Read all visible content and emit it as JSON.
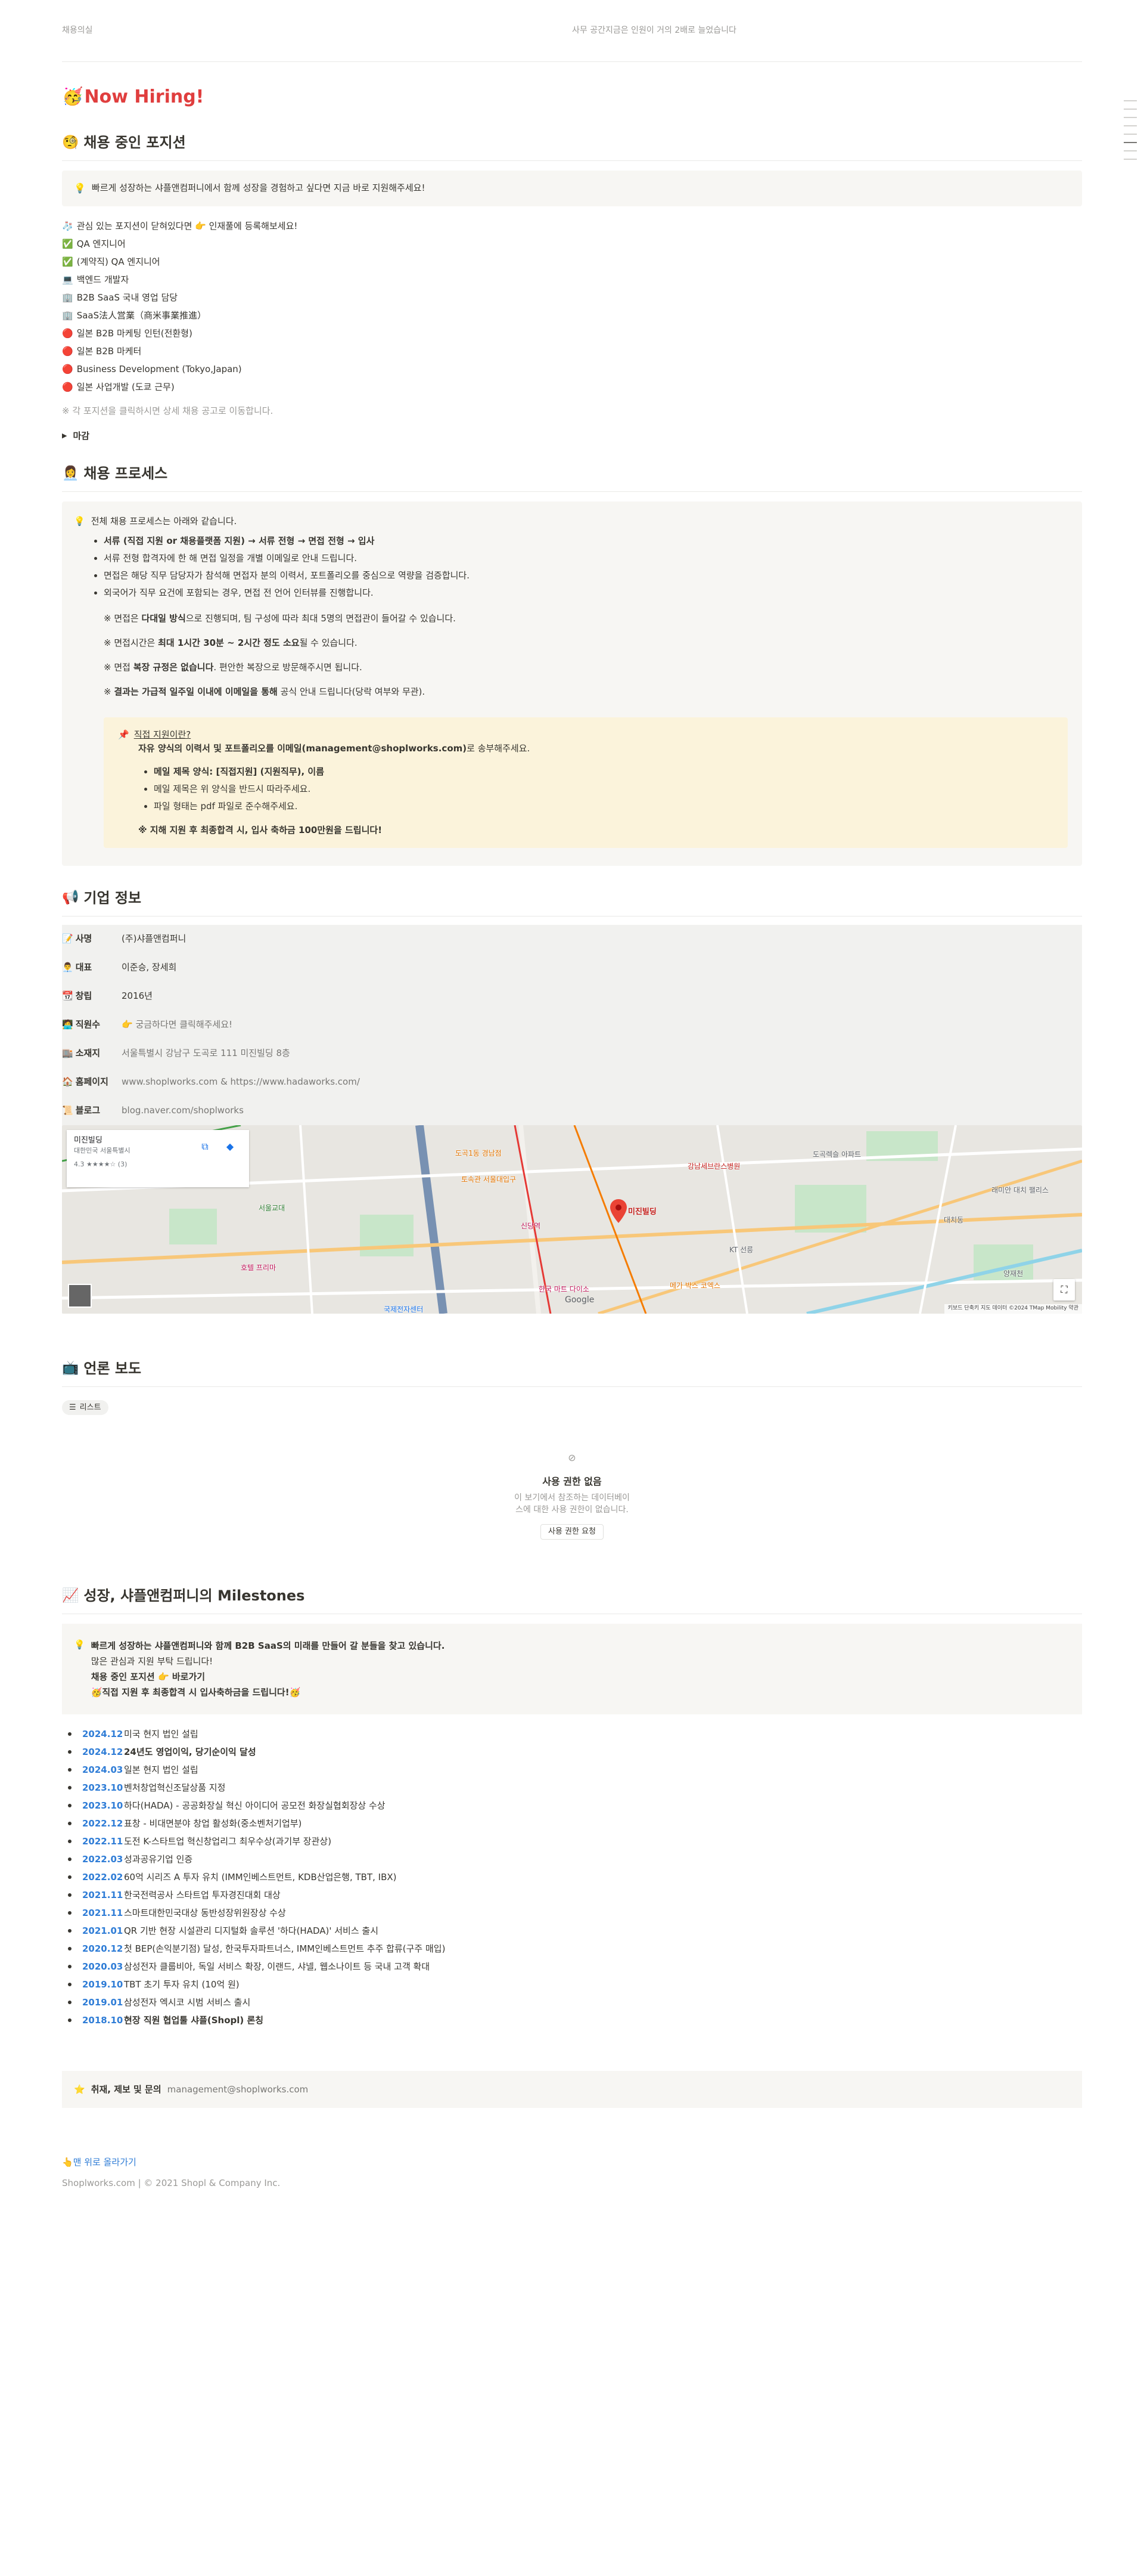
{
  "topbar": {
    "left": "채용의실",
    "right": "사무 공간지금은 인원이 거의 2배로 늘었습니다"
  },
  "hiring": {
    "emoji": "🥳",
    "title": "Now Hiring!"
  },
  "positions": {
    "heading_emoji": "🧐",
    "heading": "채용 중인 포지션",
    "callout_icon": "💡",
    "callout": "빠르게 성장하는 샤플앤컴퍼니에서 함께 성장을 경험하고 싶다면 지금 바로 지원해주세요!",
    "items": [
      {
        "emoji": "🧦",
        "label": "관심 있는 포지션이 닫혀있다면 👉 인재풀에 등록해보세요!"
      },
      {
        "emoji": "✅",
        "label": "QA 엔지니어"
      },
      {
        "emoji": "✅",
        "label": "(계약직) QA 엔지니어"
      },
      {
        "emoji": "💻",
        "label": "백엔드 개발자"
      },
      {
        "emoji": "🏢",
        "label": "B2B SaaS 국내 영업 담당"
      },
      {
        "emoji": "🏢",
        "label": "SaaS法人営業（商米事業推進）"
      },
      {
        "emoji": "🔴",
        "label": "일본 B2B 마케팅 인턴(전환형)"
      },
      {
        "emoji": "🔴",
        "label": "일본 B2B 마케터"
      },
      {
        "emoji": "🔴",
        "label": "Business Development (Tokyo,Japan)"
      },
      {
        "emoji": "🔴",
        "label": "일본 사업개발 (도쿄 근무)"
      }
    ],
    "note": "※ 각 포지션을 클릭하시면 상세 채용 공고로 이동합니다.",
    "toggle": "마감"
  },
  "process": {
    "heading_emoji": "👩‍💼",
    "heading": "채용 프로세스",
    "intro_icon": "💡",
    "intro": "전체 채용 프로세스는 아래와 같습니다.",
    "flow": "서류 (직접 지원 or 채용플랫폼 지원) → 서류 전형 → 면접 전형 → 입사",
    "bullets": [
      "서류 전형 합격자에 한 해 면접 일정을 개별 이메일로 안내 드립니다.",
      "면접은 해당 직무 담당자가 참석해 면접자 분의 이력서, 포트폴리오를 중심으로 역량을 검증합니다.",
      "외국어가 직무 요건에 포함되는 경우, 면접 전 언어 인터뷰를 진행합니다."
    ],
    "rule1_a": "※ 면접은 ",
    "rule1_b": "다대일 방식",
    "rule1_c": "으로 진행되며, 팀 구성에 따라 최대 5명의 면접관이 들어갈 수 있습니다.",
    "rule2_a": "※ 면접시간은 ",
    "rule2_b": "최대 1시간 30분 ~ 2시간 정도 소요",
    "rule2_c": "될 수 있습니다.",
    "rule3_a": "※ 면접 ",
    "rule3_b": "복장 규정은 없습니다",
    "rule3_c": ". 편안한 복장으로 방문해주시면 됩니다.",
    "rule4_a": "※ ",
    "rule4_b": "결과는 가급적 일주일 이내에 이메일을 통해",
    "rule4_c": " 공식 안내 드립니다(당락 여부와 무관).",
    "apply": {
      "icon": "📌",
      "title": "직접 지원이란?",
      "line_a": "자유 양식의 이력서 및 포트폴리오를 이메일(management@shoplworks.com)",
      "line_b": "로 송부해주세요.",
      "items": [
        "메일 제목 양식: [직접지원] (지원직무), 이름",
        "메일 제목은 위 양식을 반드시 따라주세요.",
        "파일 형태는 pdf 파일로 준수해주세요."
      ],
      "bonus": "※ 지해 지원 후 최종합격 시, 입사 축하금 100만원을 드립니다!"
    }
  },
  "company": {
    "heading_emoji": "📢",
    "heading": "기업 정보",
    "rows": [
      {
        "emoji": "📝",
        "key": "사명",
        "value": "(주)샤플앤컴퍼니"
      },
      {
        "emoji": "👨‍💼",
        "key": "대표",
        "value": "이준승, 장세희"
      },
      {
        "emoji": "📆",
        "key": "창립",
        "value": "2016년"
      },
      {
        "emoji": "🧑‍💻",
        "key": "직원수",
        "value": "👉 궁금하다면 클릭해주세요!"
      },
      {
        "emoji": "🏬",
        "key": "소재지",
        "value": "서울특별시 강남구 도곡로 111 미진빌딩 8층"
      },
      {
        "emoji": "🏠",
        "key": "홈페이지",
        "value": "www.shoplworks.com & https://www.hadaworks.com/"
      },
      {
        "emoji": "📜",
        "key": "블로그",
        "value": "blog.naver.com/shoplworks"
      }
    ]
  },
  "map": {
    "place": "미진빌딩",
    "address": "대한민국 서울특별시",
    "rating": "4.3 ★★★★☆ (3)",
    "pin_label": "미진빌딩",
    "attribution": "키보드 단축키  지도 데이터 ©2024 TMap Mobility  약관",
    "google": "Google",
    "labels": [
      {
        "text": "도곡렉슬 아파트",
        "color": "#5f6368"
      },
      {
        "text": "강남세브란스병원",
        "color": "#c5221f"
      },
      {
        "text": "래미안 대치 팰리스",
        "color": "#5f6368"
      },
      {
        "text": "대치동",
        "color": "#5f6368"
      },
      {
        "text": "서울교대",
        "color": "#2e7d32"
      },
      {
        "text": "국제전자센터",
        "color": "#1a73e8"
      },
      {
        "text": "KT 선릉",
        "color": "#5f6368"
      },
      {
        "text": "토속관 서울대입구",
        "color": "#e37400"
      },
      {
        "text": "도곡1동 경남점",
        "color": "#e37400"
      },
      {
        "text": "한국 마트 다이소",
        "color": "#c2185b"
      },
      {
        "text": "호텔 프리마",
        "color": "#c2185b"
      },
      {
        "text": "메가 박스 코엑스",
        "color": "#e37400"
      },
      {
        "text": "양재천",
        "color": "#5f6368"
      },
      {
        "text": "신당역",
        "color": "#c2185b"
      }
    ]
  },
  "press": {
    "heading_emoji": "📺",
    "heading": "언론 보도",
    "tab": "리스트",
    "noperm_title": "사용 권한 없음",
    "noperm_desc1": "이 보기에서 참조하는 데이터베이",
    "noperm_desc2": "스에 대한 사용 권한이 없습니다.",
    "noperm_button": "사용 권한 요청"
  },
  "milestones": {
    "heading_emoji": "📈",
    "heading": "성장, 샤플앤컴퍼니의 Milestones",
    "callout_icon": "💡",
    "callout_lines": [
      "빠르게 성장하는 샤플앤컴퍼니와 함께 B2B SaaS의 미래를 만들어 갈 분들을 찾고 있습니다.",
      "많은 관심과 지원 부탁 드립니다!",
      "채용 중인 포지션 👉 바로가기",
      "🥳직접 지원 후 최종합격 시 입사축하금을 드립니다!🥳"
    ],
    "items": [
      {
        "date": "2024.12",
        "text": "미국 현지 법인 설립",
        "bold": false
      },
      {
        "date": "2024.12",
        "text": "24년도 영업이익, 당기순이익 달성",
        "bold": true
      },
      {
        "date": "2024.03",
        "text": "일본 현지 법인 설립",
        "bold": false
      },
      {
        "date": "2023.10",
        "text": "벤처창업혁신조달상품 지정",
        "bold": false
      },
      {
        "date": "2023.10",
        "text": "하다(HADA) - 공공화장실 혁신 아이디어 공모전 화장실협회장상 수상",
        "bold": false
      },
      {
        "date": "2022.12",
        "text": "표창 - 비대면분야 창업 활성화(중소벤처기업부)",
        "bold": false
      },
      {
        "date": "2022.11",
        "text": "도전 K-스타트업 혁신창업리그 최우수상(과기부 장관상)",
        "bold": false
      },
      {
        "date": "2022.03",
        "text": "성과공유기업 인증",
        "bold": false
      },
      {
        "date": "2022.02",
        "text": "60억 시리즈 A 투자 유치 (IMM인베스트먼트, KDB산업은행, TBT, IBX)",
        "bold": false
      },
      {
        "date": "2021.11",
        "text": "한국전력공사 스타트업 투자경진대회 대상",
        "bold": false
      },
      {
        "date": "2021.11",
        "text": "스마트대한민국대상 동반성장위원장상 수상",
        "bold": false
      },
      {
        "date": "2021.01",
        "text": "QR 기반 현장 시설관리 디지털화 솔루션 '하다(HADA)' 서비스 출시",
        "bold": false
      },
      {
        "date": "2020.12",
        "text": "첫 BEP(손익분기점) 달성, 한국투자파트너스, IMM인베스트먼트 추주 합류(구주 매입)",
        "bold": false
      },
      {
        "date": "2020.03",
        "text": "삼성전자 클룹비아, 독일 서비스 확장, 이랜드, 샤넬, 웹소나이트 등 국내 고객 확대",
        "bold": false
      },
      {
        "date": "2019.10",
        "text": "TBT 초기 투자 유치 (10억 원)",
        "bold": false
      },
      {
        "date": "2019.01",
        "text": "삼성전자 엑시코 시범 서비스 출시",
        "bold": false
      },
      {
        "date": "2018.10",
        "text": "현장 직원 협업툴 샤플(Shopl) 론칭",
        "bold": true
      }
    ]
  },
  "contact": {
    "icon": "⭐",
    "label": "취재, 제보 및 문의",
    "email": "management@shoplworks.com"
  },
  "footer": {
    "back": "👆맨 위로 올라가기",
    "copyright": "Shoplworks.com | © 2021 Shopl & Company Inc."
  },
  "colors": {
    "accent_red": "#e03e3e",
    "link_blue": "#2e7cd6",
    "callout_bg": "#f7f6f3",
    "apply_bg": "#fbf3db"
  }
}
